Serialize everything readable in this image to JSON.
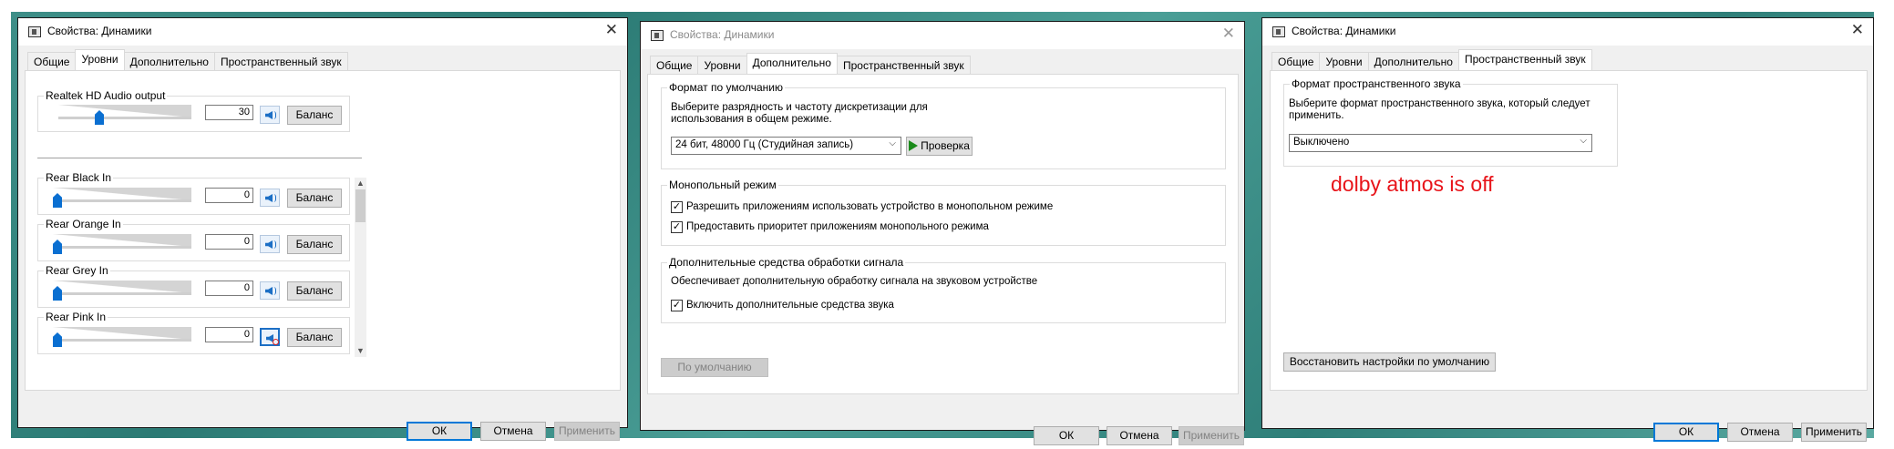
{
  "windows": {
    "levels": {
      "title": "Свойства: Динамики",
      "tabs": [
        "Общие",
        "Уровни",
        "Дополнительно",
        "Пространственный звук"
      ],
      "active_tab": "Уровни",
      "main_device": {
        "label": "Realtek HD Audio output",
        "value": "30",
        "level": 0.3,
        "balance": "Баланс"
      },
      "inputs": [
        {
          "label": "Rear Black In",
          "value": "0",
          "balance": "Баланс",
          "muted": false
        },
        {
          "label": "Rear Orange In",
          "value": "0",
          "balance": "Баланс",
          "muted": false
        },
        {
          "label": "Rear Grey In",
          "value": "0",
          "balance": "Баланс",
          "muted": false
        },
        {
          "label": "Rear Pink In",
          "value": "0",
          "balance": "Баланс",
          "muted": true
        }
      ],
      "buttons": {
        "ok": "ОК",
        "cancel": "Отмена",
        "apply": "Применить"
      }
    },
    "advanced": {
      "title": "Свойства: Динамики",
      "tabs": [
        "Общие",
        "Уровни",
        "Дополнительно",
        "Пространственный звук"
      ],
      "active_tab": "Дополнительно",
      "default_format": {
        "group_title": "Формат по умолчанию",
        "description_line1": "Выберите разрядность и частоту дискретизации для",
        "description_line2": "использования в общем режиме.",
        "selected": "24 бит, 48000 Гц (Студийная запись)",
        "test_button": "Проверка"
      },
      "exclusive_mode": {
        "group_title": "Монопольный режим",
        "option1": "Разрешить приложениям использовать устройство в монопольном режиме",
        "option1_checked": true,
        "option2": "Предоставить приоритет приложениям монопольного режима",
        "option2_checked": true
      },
      "enhancements": {
        "group_title": "Дополнительные средства обработки сигнала",
        "description": "Обеспечивает дополнительную обработку сигнала на звуковом устройстве",
        "option": "Включить дополнительные средства звука",
        "option_checked": true
      },
      "restore_default": "По умолчанию",
      "buttons": {
        "ok": "ОК",
        "cancel": "Отмена",
        "apply": "Применить"
      }
    },
    "spatial": {
      "title": "Свойства: Динамики",
      "tabs": [
        "Общие",
        "Уровни",
        "Дополнительно",
        "Пространственный звук"
      ],
      "active_tab": "Пространственный звук",
      "format": {
        "group_title": "Формат пространственного звука",
        "description_line1": "Выберите формат пространственного звука, который следует",
        "description_line2": "применить.",
        "selected": "Выключено"
      },
      "annotation": "dolby atmos is off",
      "restore_defaults": "Восстановить настройки по умолчанию",
      "buttons": {
        "ok": "ОК",
        "cancel": "Отмена",
        "apply": "Применить"
      }
    }
  },
  "colors": {
    "accent": "#0078d7",
    "annotation": "#e8141a",
    "slider_thumb": "#0a6fd1"
  },
  "icons": [
    "speaker-icon",
    "speaker-muted-icon",
    "close-icon",
    "dropdown-arrow-icon",
    "play-icon",
    "checkbox-checked-icon",
    "scroll-up-icon",
    "scroll-down-icon",
    "window-app-icon"
  ]
}
